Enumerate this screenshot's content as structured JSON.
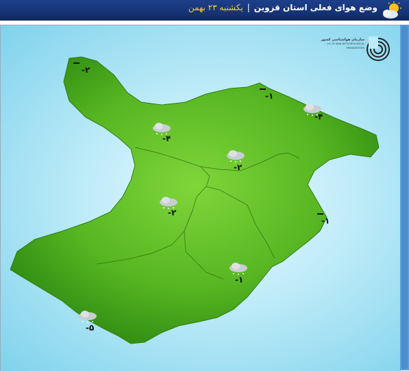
{
  "header": {
    "title": "وضع هوای فعلی استان قزوین",
    "separator": "|",
    "date": "یکشنبه ۲۳ بهمن",
    "icon": "sun-behind-cloud-icon"
  },
  "logo": {
    "name_fa": "سازمان هواشناسی کشور",
    "name_en": "I.R. OF IRAN METEOROLOGICAL ORGANIZATION",
    "icon": "irimo-logo-icon"
  },
  "stations": [
    {
      "id": "nw",
      "temp": "-۲",
      "icon": "none"
    },
    {
      "id": "ne",
      "temp": "-۱",
      "icon": "none"
    },
    {
      "id": "ne-cloud",
      "temp": "-۴",
      "icon": "snow-cloud-icon"
    },
    {
      "id": "w",
      "temp": "-۴",
      "icon": "snow-cloud-icon"
    },
    {
      "id": "c",
      "temp": "-۲",
      "icon": "snow-cloud-icon"
    },
    {
      "id": "cw",
      "temp": "-۲",
      "icon": "snow-cloud-icon"
    },
    {
      "id": "e",
      "temp": "-۱",
      "icon": "none"
    },
    {
      "id": "se",
      "temp": "-۱",
      "icon": "snow-cloud-icon"
    },
    {
      "id": "sw",
      "temp": "-۵",
      "icon": "snow-cloud-icon"
    }
  ],
  "colors": {
    "header": "#163476",
    "map_fill": "#5fbf2a",
    "background": "#bdebf8",
    "date": "#ffcc33"
  }
}
